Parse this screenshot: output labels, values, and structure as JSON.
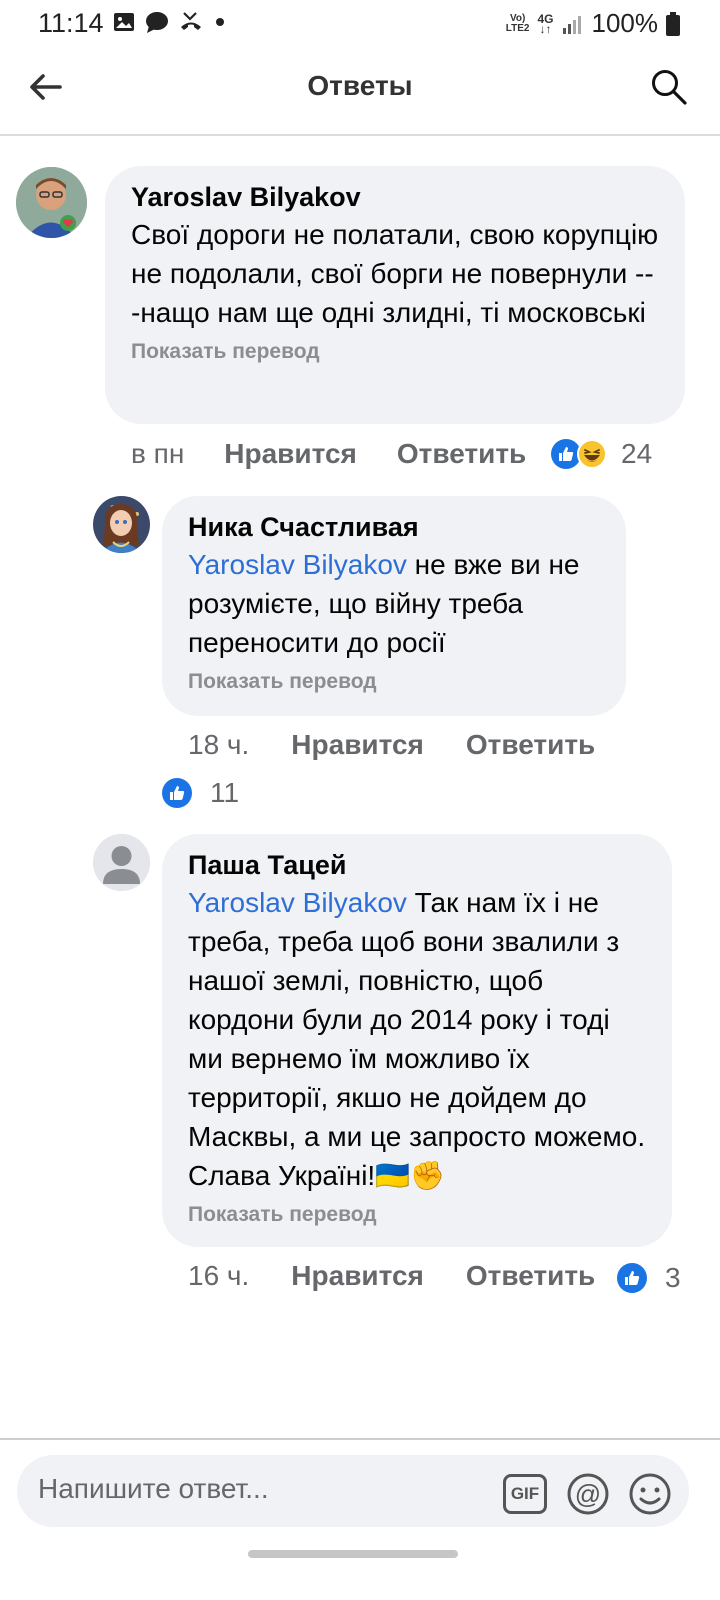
{
  "status_bar": {
    "time": "11:14",
    "network_top": "Vo)",
    "network_bottom": "LTE2",
    "network_type": "4G",
    "battery": "100%"
  },
  "header": {
    "title": "Ответы"
  },
  "comments": [
    {
      "author": "Yaroslav Bilyakov",
      "text": "Свої дороги не полатали, свою корупцію не подолали, свої борги не повернули ---нащо нам ще одні злидні, ті московські",
      "translate": "Показать перевод",
      "time": "в пн",
      "like_label": "Нравится",
      "reply_label": "Ответить",
      "reaction_count": "24"
    },
    {
      "author": "Ника Счастливая",
      "mention": "Yaroslav Bilyakov",
      "text": " не вже ви не розумієте, що війну треба переносити до росії",
      "translate": "Показать перевод",
      "time": "18 ч.",
      "like_label": "Нравится",
      "reply_label": "Ответить",
      "reaction_count": "11"
    },
    {
      "author": "Паша Тацей",
      "mention": "Yaroslav Bilyakov",
      "text": " Так нам їх і не треба, треба щоб вони звалили з нашої землі, повністю, щоб кордони були до 2014 року і тоді ми вернемо їм можливо їх территорії, якшо не дойдем до Масквы, а ми це запросто можемо. Слава Україні!🇺🇦✊",
      "translate": "Показать перевод",
      "time": "16 ч.",
      "like_label": "Нравится",
      "reply_label": "Ответить",
      "reaction_count": "3"
    }
  ],
  "composer": {
    "placeholder": "Напишите ответ...",
    "gif_label": "GIF"
  },
  "colors": {
    "accent": "#1b74e4",
    "mention": "#2e6fd6",
    "bubble": "#f0f2f5",
    "secondary_text": "#65676b"
  }
}
